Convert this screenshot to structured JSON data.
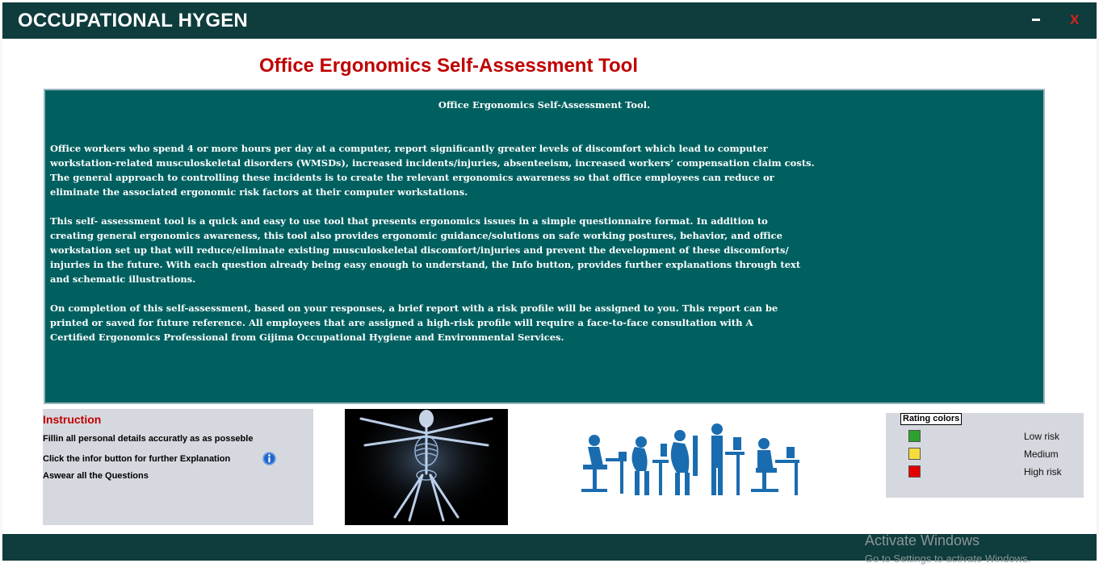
{
  "app": {
    "title": "OCCUPATIONAL HYGEN",
    "minimize_label": "",
    "close_label": "X"
  },
  "page": {
    "title": "Office Ergonomics Self-Assessment Tool"
  },
  "description": {
    "title": "Office Ergonomics Self-Assessment Tool.",
    "paragraph1": "Office workers who spend 4 or more hours per day at a computer, report significantly greater levels of discomfort which lead to computer\nworkstation-related musculoskeletal disorders (WMSDs), increased incidents/injuries, absenteeism, increased workers’ compensation claim costs.\nThe general approach to controlling these incidents is to create the relevant ergonomics awareness so that office employees can reduce or\neliminate the associated ergonomic risk factors at their computer workstations.",
    "paragraph2": "This self- assessment tool is a quick and easy to use tool that presents ergonomics issues in a simple questionnaire format.  In addition to\ncreating general ergonomics awareness, this tool also provides ergonomic guidance/solutions on safe working postures, behavior, and office\nworkstation set up that will reduce/eliminate existing musculoskeletal discomfort/injuries and prevent the development of these discomforts/\ninjuries in the future. With each question already being easy enough to understand, the Info button, provides further explanations through text\nand schematic illustrations.",
    "paragraph3": "On completion of this self-assessment, based on your responses, a brief report with a risk profile will be assigned to you.  This report can be\nprinted or saved for future reference.  All employees that are assigned a high-risk profile will require a face-to-face consultation with A\nCertified Ergonomics Professional from Gijima Occupational Hygiene and Environmental Services."
  },
  "instruction": {
    "heading": "Instruction",
    "line1": "Fillin all personal details accuratly as as posseble",
    "line2": "Click the infor button for further Explanation",
    "line3": "Aswear all the Questions"
  },
  "rating": {
    "heading": "Rating colors",
    "items": [
      {
        "label": "Low risk",
        "color": "#2ea12e"
      },
      {
        "label": "Medium",
        "color": "#f5dc3c"
      },
      {
        "label": "High risk",
        "color": "#e50000"
      }
    ]
  },
  "watermark": {
    "line1": "Activate Windows",
    "line2": "Go to Settings to activate Windows."
  },
  "colors": {
    "header_bg": "#0f3c3c",
    "panel_teal": "#006060",
    "title_red": "#c00000",
    "figure_blue": "#1a6cb0"
  },
  "icons": [
    "minimize-icon",
    "close-icon",
    "info-icon",
    "xray-skeleton-image",
    "posture-figures-image"
  ]
}
